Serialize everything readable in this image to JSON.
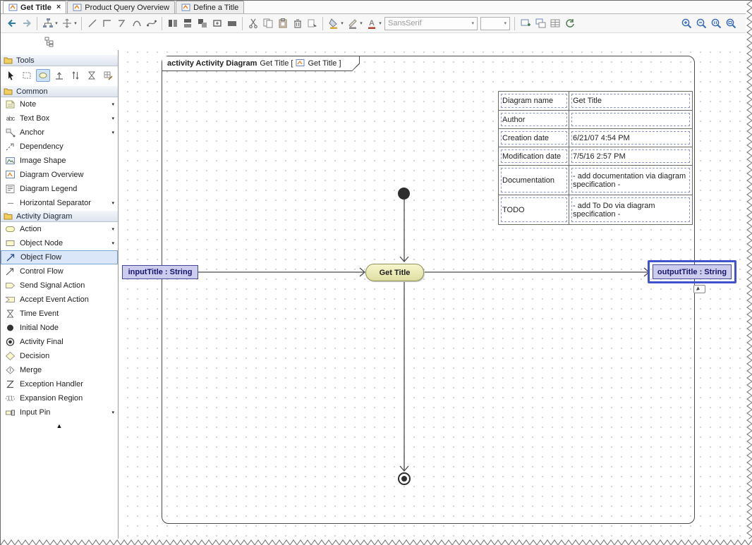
{
  "icons": {
    "close": "×",
    "chevron_down": "▾",
    "scroll_up": "▲",
    "abc": "abc",
    "dashes": "----",
    "back": "arrow-left",
    "forward": "arrow-right",
    "layout": "tree-layout",
    "magnet": "quick-layout",
    "zoom_in": "magnifier-plus",
    "zoom_out": "magnifier-minus",
    "zoom_11": "magnifier-1-1",
    "zoom_fit": "magnifier-fit"
  },
  "tabs": [
    {
      "label": "Get Title",
      "active": true
    },
    {
      "label": "Product Query Overview",
      "active": false
    },
    {
      "label": "Define a Title",
      "active": false
    }
  ],
  "toolbar": {
    "font_combo": "SansSerif",
    "size_combo": ""
  },
  "sidebar": {
    "sections": [
      {
        "title": "Tools"
      },
      {
        "title": "Common",
        "items": [
          {
            "label": "Note",
            "dropdown": true
          },
          {
            "label": "Text Box",
            "dropdown": true
          },
          {
            "label": "Anchor",
            "dropdown": true
          },
          {
            "label": "Dependency"
          },
          {
            "label": "Image Shape"
          },
          {
            "label": "Diagram Overview"
          },
          {
            "label": "Diagram Legend"
          },
          {
            "label": "Horizontal Separator",
            "dropdown": true
          }
        ]
      },
      {
        "title": "Activity Diagram",
        "items": [
          {
            "label": "Action",
            "dropdown": true
          },
          {
            "label": "Object Node",
            "dropdown": true
          },
          {
            "label": "Object Flow",
            "selected": true
          },
          {
            "label": "Control Flow"
          },
          {
            "label": "Send Signal Action"
          },
          {
            "label": "Accept Event Action"
          },
          {
            "label": "Time Event"
          },
          {
            "label": "Initial Node"
          },
          {
            "label": "Activity Final"
          },
          {
            "label": "Decision"
          },
          {
            "label": "Merge"
          },
          {
            "label": "Exception Handler"
          },
          {
            "label": "Expansion Region"
          },
          {
            "label": "Input Pin",
            "dropdown": true
          }
        ]
      }
    ]
  },
  "canvas": {
    "frame": {
      "keyword": "activity Activity Diagram",
      "name": "Get Title [",
      "ref": "Get Title ]"
    },
    "nodes": {
      "action": "Get Title",
      "input_object": "inputTitle : String",
      "output_object": "outputTitle : String"
    },
    "info_table": {
      "rows": [
        {
          "key": "Diagram name",
          "value": "Get Title"
        },
        {
          "key": "Author",
          "value": ""
        },
        {
          "key": "Creation date",
          "value": "6/21/07 4:54 PM"
        },
        {
          "key": "Modification date",
          "value": "7/5/16 2:57 PM"
        },
        {
          "key": "Documentation",
          "value": "- add documentation via diagram specification -"
        },
        {
          "key": "TODO",
          "value": "- add To Do via diagram specification -"
        }
      ]
    }
  }
}
